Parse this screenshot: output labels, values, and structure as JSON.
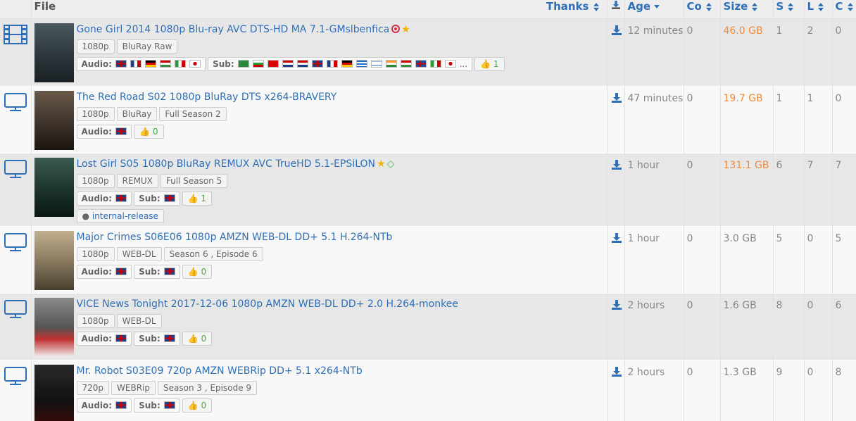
{
  "header": {
    "file": "File",
    "thanks": "Thanks",
    "age": "Age",
    "co": "Co",
    "size": "Size",
    "s": "S",
    "l": "L",
    "c": "C"
  },
  "colors": {
    "link": "#2e6fb7",
    "orange": "#f08a3c",
    "green": "#4ca64c",
    "zebra": "#e7e7e8"
  },
  "rows": [
    {
      "icon": "film-icon",
      "title": "Gone Girl 2014 1080p Blu-ray AVC DTS-HD MA 7.1-GMslbenfica",
      "tags": [
        "1080p",
        "BluRay Raw"
      ],
      "audio_label": "Audio:",
      "sub_label": "Sub:",
      "sub_more": "...",
      "thumbs": "1",
      "age": "12 minutes",
      "co": "0",
      "size": "46.0 GB",
      "s": "1",
      "l": "2",
      "c": "0"
    },
    {
      "icon": "monitor-icon",
      "title": "The Red Road S02 1080p BluRay DTS x264-BRAVERY",
      "tags": [
        "1080p",
        "BluRay",
        "Full Season 2"
      ],
      "audio_label": "Audio:",
      "thumbs": "0",
      "age": "47 minutes",
      "co": "0",
      "size": "19.7 GB",
      "s": "1",
      "l": "1",
      "c": "0"
    },
    {
      "icon": "monitor-icon",
      "title": "Lost Girl S05 1080p BluRay REMUX AVC TrueHD 5.1-EPSiLON",
      "tags": [
        "1080p",
        "REMUX",
        "Full Season 5"
      ],
      "audio_label": "Audio:",
      "sub_label": "Sub:",
      "thumbs": "1",
      "internal": "internal-release",
      "age": "1 hour",
      "co": "0",
      "size": "131.1 GB",
      "s": "6",
      "l": "7",
      "c": "7"
    },
    {
      "icon": "monitor-icon",
      "title": "Major Crimes S06E06 1080p AMZN WEB-DL DD+ 5.1 H.264-NTb",
      "tags": [
        "1080p",
        "WEB-DL",
        "Season 6 , Episode 6"
      ],
      "audio_label": "Audio:",
      "sub_label": "Sub:",
      "thumbs": "0",
      "age": "1 hour",
      "co": "0",
      "size": "3.0 GB",
      "s": "5",
      "l": "0",
      "c": "5"
    },
    {
      "icon": "monitor-icon",
      "title": "VICE News Tonight 2017-12-06 1080p AMZN WEB-DL DD+ 2.0 H.264-monkee",
      "tags": [
        "1080p",
        "WEB-DL"
      ],
      "audio_label": "Audio:",
      "sub_label": "Sub:",
      "thumbs": "0",
      "age": "2 hours",
      "co": "0",
      "size": "1.6 GB",
      "s": "8",
      "l": "0",
      "c": "6"
    },
    {
      "icon": "monitor-icon",
      "title": "Mr. Robot S03E09 720p AMZN WEBRip DD+ 5.1 x264-NTb",
      "tags": [
        "720p",
        "WEBRip",
        "Season 3 , Episode 9"
      ],
      "audio_label": "Audio:",
      "sub_label": "Sub:",
      "thumbs": "0",
      "age": "2 hours",
      "co": "0",
      "size": "1.3 GB",
      "s": "9",
      "l": "0",
      "c": "8"
    }
  ]
}
